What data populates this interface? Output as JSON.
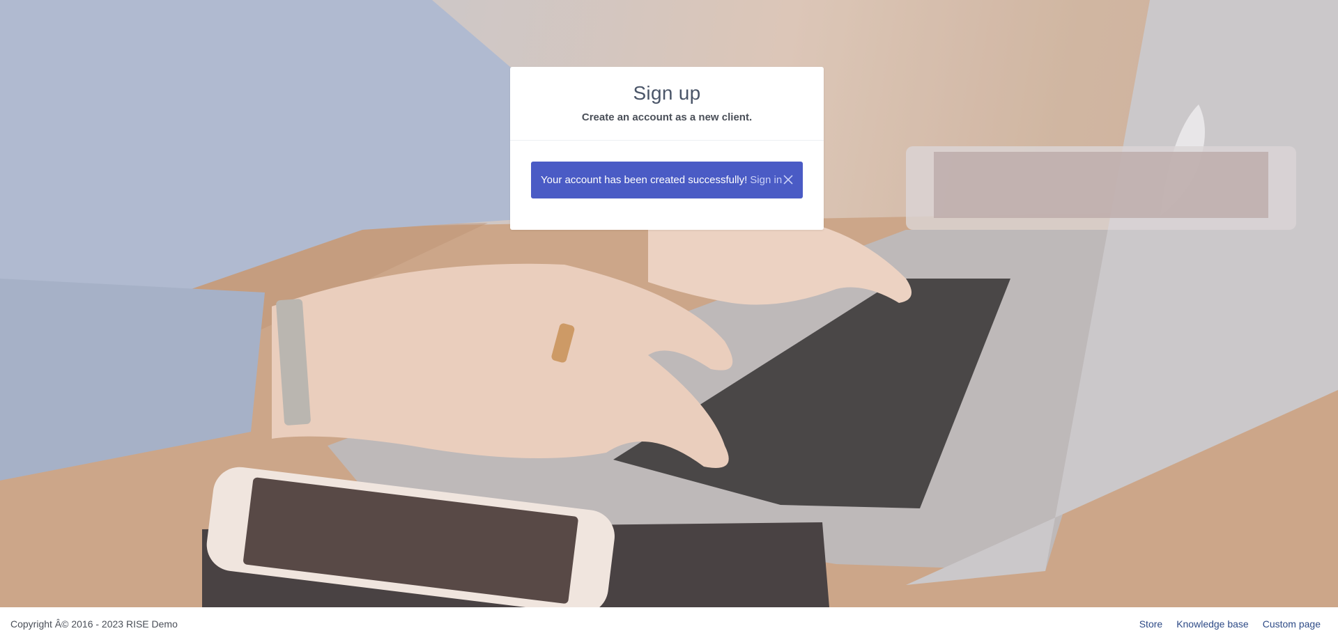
{
  "card": {
    "title": "Sign up",
    "subtitle": "Create an account as a new client."
  },
  "alert": {
    "message": "Your account has been created successfully!",
    "link_label": "Sign in",
    "close_icon": "close-icon"
  },
  "footer": {
    "copyright": "Copyright Â© 2016 - 2023 RISE Demo",
    "links": [
      "Store",
      "Knowledge base",
      "Custom page"
    ]
  },
  "colors": {
    "alert_bg": "#4a5bc5",
    "footer_link": "#2d4a86"
  }
}
